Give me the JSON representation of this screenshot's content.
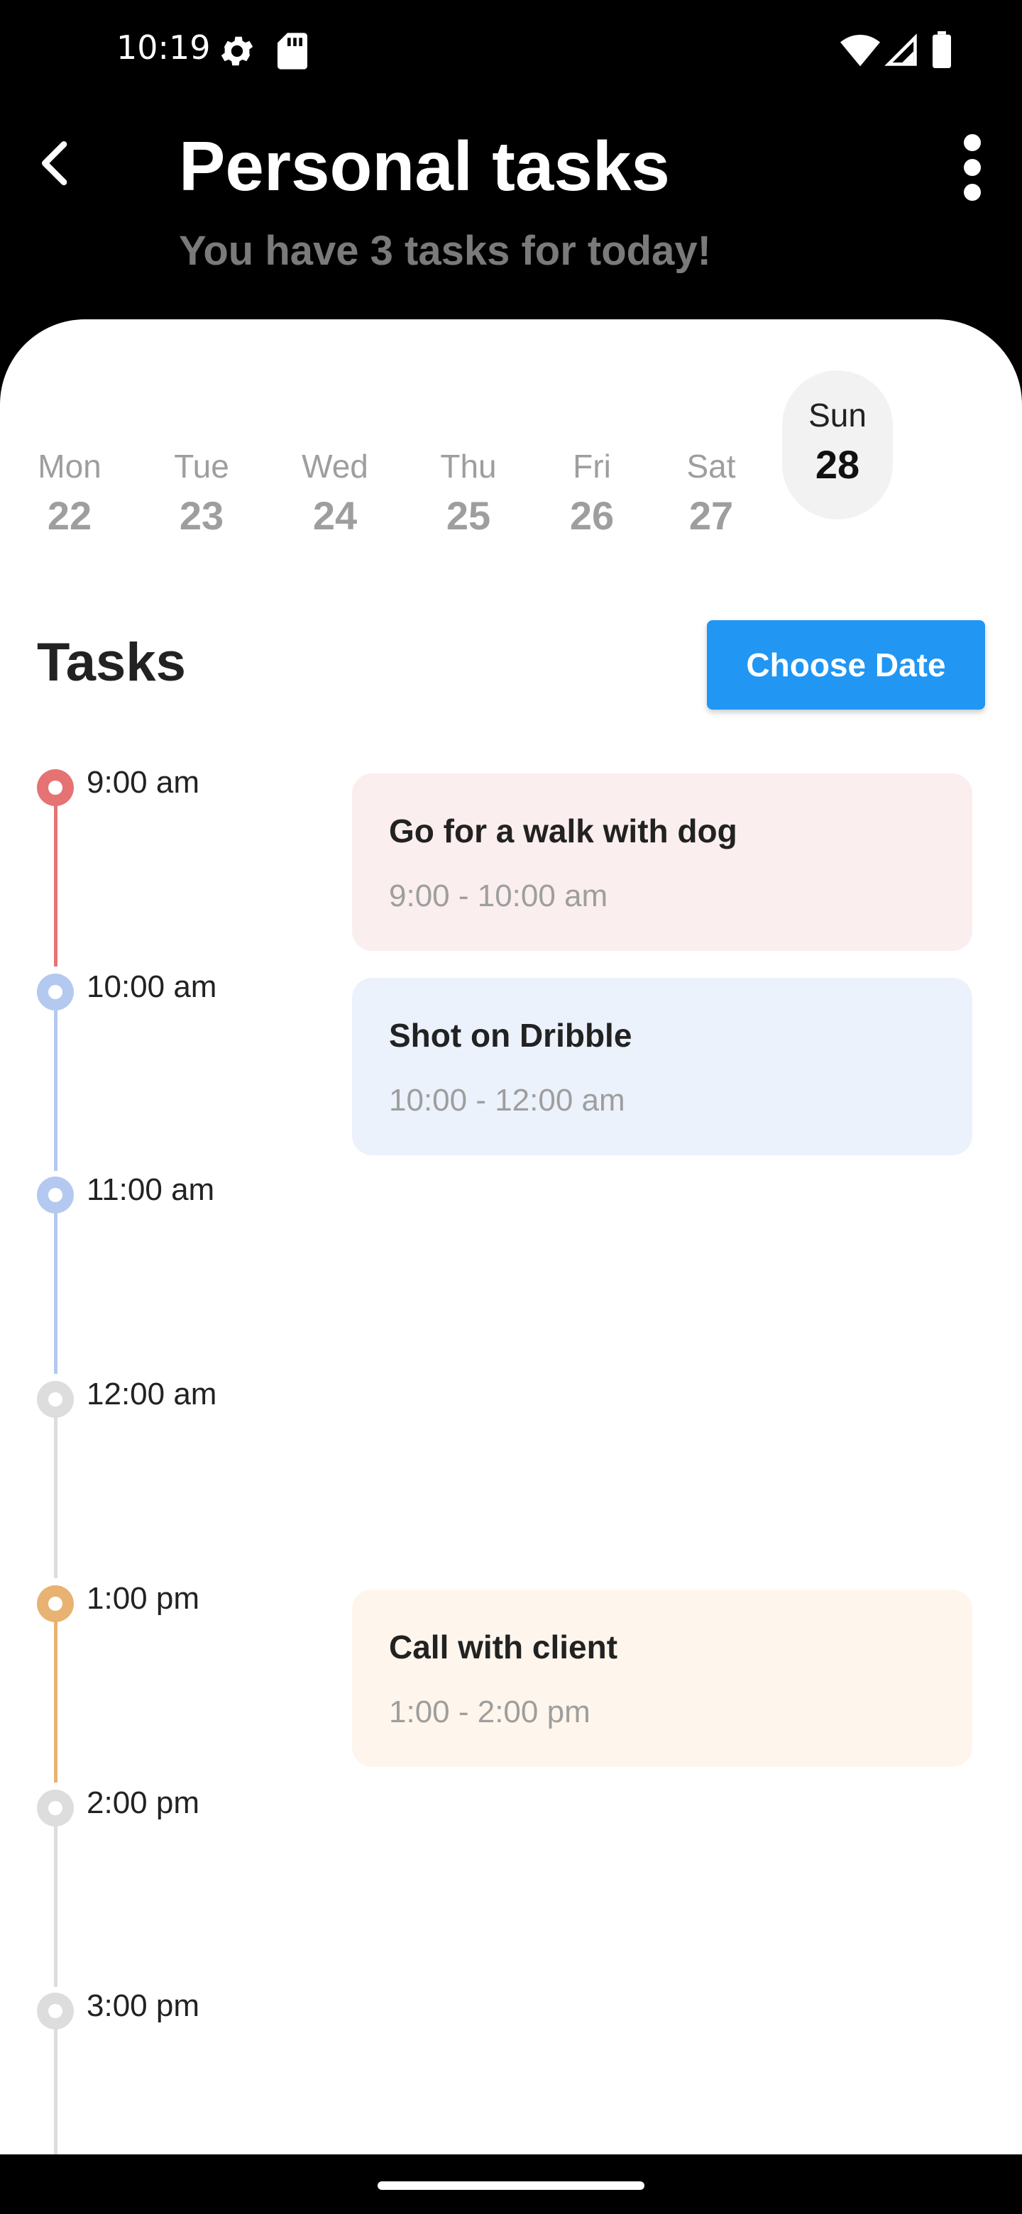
{
  "status_bar": {
    "time": "10:19"
  },
  "header": {
    "title": "Personal tasks",
    "subtitle": "You have 3 tasks for today!"
  },
  "week": [
    {
      "name": "Mon",
      "num": "22",
      "selected": false
    },
    {
      "name": "Tue",
      "num": "23",
      "selected": false
    },
    {
      "name": "Wed",
      "num": "24",
      "selected": false
    },
    {
      "name": "Thu",
      "num": "25",
      "selected": false
    },
    {
      "name": "Fri",
      "num": "26",
      "selected": false
    },
    {
      "name": "Sat",
      "num": "27",
      "selected": false
    },
    {
      "name": "Sun",
      "num": "28",
      "selected": true
    }
  ],
  "tasks_section": {
    "heading": "Tasks",
    "choose_date_label": "Choose Date"
  },
  "timeline": [
    {
      "time": "9:00 am",
      "color": "#e57373"
    },
    {
      "time": "10:00 am",
      "color": "#b4c9f0"
    },
    {
      "time": "11:00 am",
      "color": "#b4c9f0"
    },
    {
      "time": "12:00 am",
      "color": "#dddddd"
    },
    {
      "time": "1:00 pm",
      "color": "#e8b272"
    },
    {
      "time": "2:00 pm",
      "color": "#dddddd"
    },
    {
      "time": "3:00 pm",
      "color": "#dddddd"
    }
  ],
  "tasks": [
    {
      "title": "Go for a walk with dog",
      "time": "9:00 - 10:00 am",
      "bg": "#fbeeee"
    },
    {
      "title": "Shot on Dribble",
      "time": "10:00 - 12:00 am",
      "bg": "#ecf2fc"
    },
    {
      "title": "Call with client",
      "time": "1:00 - 2:00 pm",
      "bg": "#fef6ec"
    }
  ],
  "colors": {
    "accent": "#2196f3"
  }
}
